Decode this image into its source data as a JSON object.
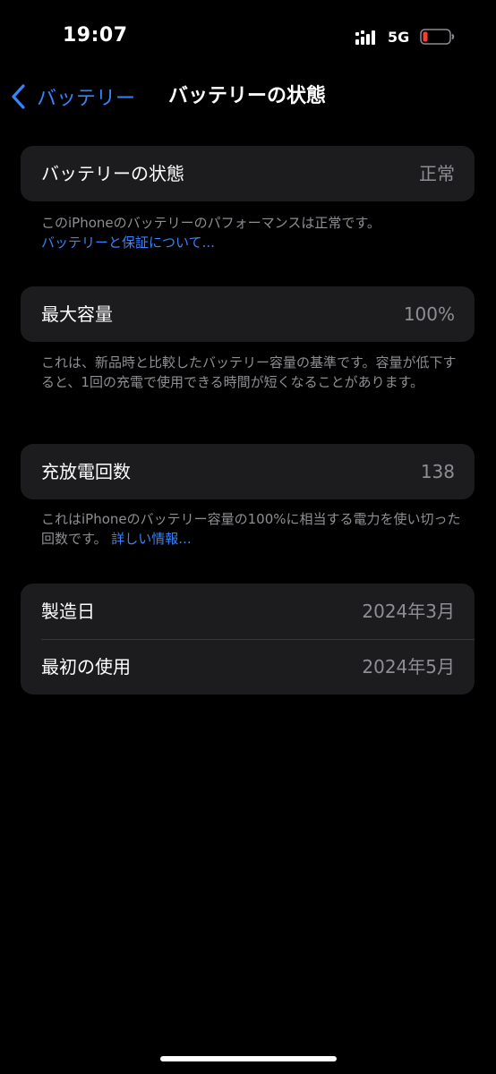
{
  "status_bar": {
    "time": "19:07",
    "network": "5G",
    "signal_icon": "signal-bars-icon",
    "battery_icon": "battery-low-icon",
    "battery_color": "#ff3b30"
  },
  "nav": {
    "back_label": "バッテリー",
    "title": "バッテリーの状態",
    "accent_color": "#3a82f7"
  },
  "battery_health": {
    "label": "バッテリーの状態",
    "value": "正常",
    "description": "このiPhoneのバッテリーのパフォーマンスは正常です。",
    "link": "バッテリーと保証について..."
  },
  "max_capacity": {
    "label": "最大容量",
    "value": "100%",
    "description": "これは、新品時と比較したバッテリー容量の基準です。容量が低下すると、1回の充電で使用できる時間が短くなることがあります。"
  },
  "cycle_count": {
    "label": "充放電回数",
    "value": "138",
    "description": "これはiPhoneのバッテリー容量の100%に相当する電力を使い切った回数です。",
    "link": "詳しい情報..."
  },
  "dates": {
    "manufacture_label": "製造日",
    "manufacture_value": "2024年3月",
    "first_use_label": "最初の使用",
    "first_use_value": "2024年5月"
  }
}
